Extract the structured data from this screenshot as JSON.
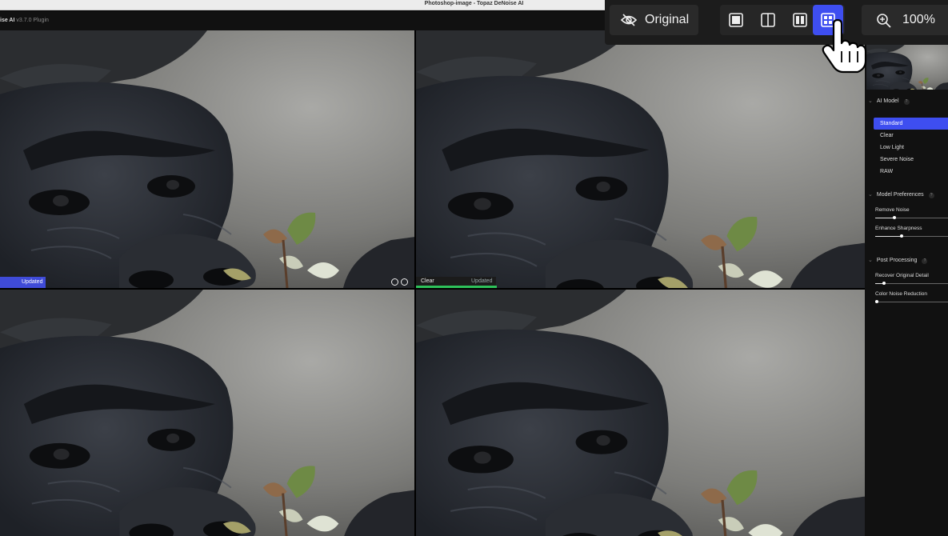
{
  "window": {
    "title": "Photoshop-image - Topaz DeNoise AI"
  },
  "app": {
    "name": "ise AI",
    "version": "v3.7.0 Plugin"
  },
  "panes": [
    {
      "status": "Updated"
    },
    {
      "model": "Clear",
      "status": "Updated",
      "progress": 0.18
    },
    {},
    {}
  ],
  "toolbar": {
    "original_label": "Original",
    "view_modes": [
      {
        "icon": "single-view-icon",
        "active": false
      },
      {
        "icon": "split-view-icon",
        "active": false
      },
      {
        "icon": "side-by-side-view-icon",
        "active": false
      },
      {
        "icon": "quad-view-icon",
        "active": true
      }
    ],
    "zoom_label": "100%"
  },
  "panel": {
    "ai_model": {
      "title": "AI Model",
      "help": "?",
      "items": [
        "Standard",
        "Clear",
        "Low Light",
        "Severe Noise",
        "RAW"
      ],
      "selected": "Standard"
    },
    "model_preferences": {
      "title": "Model Preferences",
      "help": "?",
      "sliders": [
        {
          "label": "Remove Noise",
          "value": 0.26
        },
        {
          "label": "Enhance Sharpness",
          "value": 0.36
        }
      ]
    },
    "post_processing": {
      "title": "Post Processing",
      "help": "?",
      "sliders": [
        {
          "label": "Recover Original Detail",
          "value": 0.12
        },
        {
          "label": "Color Noise Reduction",
          "value": 0.02
        }
      ]
    }
  },
  "colors": {
    "accent": "#3e4ef0",
    "progress": "#2ec15a",
    "panel_bg": "#111111"
  }
}
